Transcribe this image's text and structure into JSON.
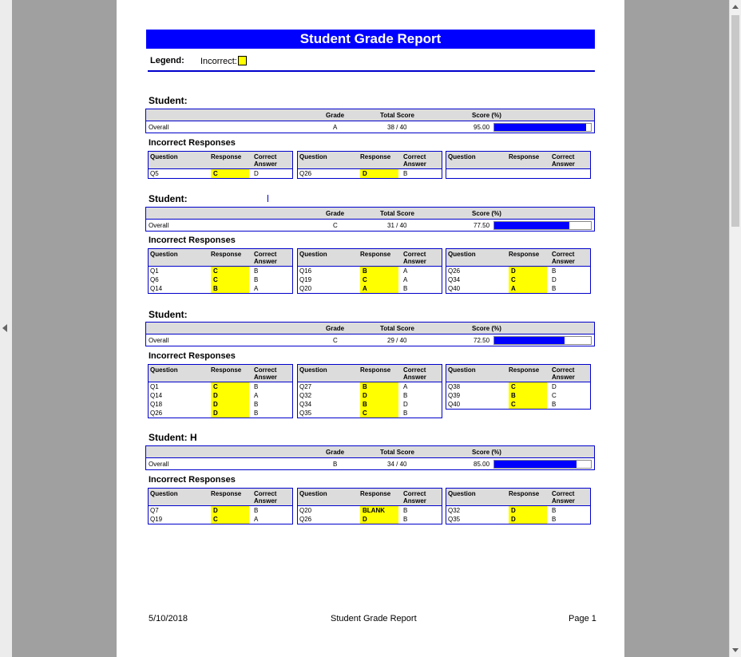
{
  "report": {
    "title": "Student Grade Report",
    "legend_label": "Legend:",
    "legend_incorrect": "Incorrect:",
    "highlight_color": "#ffff00",
    "accent_color": "#0000ff"
  },
  "labels": {
    "grade": "Grade",
    "total_score": "Total Score",
    "score_pct": "Score (%)",
    "incorrect_responses": "Incorrect Responses",
    "question": "Question",
    "response": "Response",
    "correct": "Correct",
    "answer": "Answer"
  },
  "students": [
    {
      "label": "Student:",
      "row": "Overall",
      "grade": "A",
      "total": "38 / 40",
      "pct": "95.00",
      "fraction": 0.95,
      "tables": [
        [
          [
            "Q5",
            "C",
            "D"
          ]
        ],
        [
          [
            "Q26",
            "D",
            "B"
          ]
        ],
        []
      ]
    },
    {
      "label": "Student:",
      "row": "Overall",
      "grade": "C",
      "total": "31 / 40",
      "pct": "77.50",
      "fraction": 0.775,
      "tables": [
        [
          [
            "Q1",
            "C",
            "B"
          ],
          [
            "Q6",
            "C",
            "B"
          ],
          [
            "Q14",
            "B",
            "A"
          ]
        ],
        [
          [
            "Q16",
            "B",
            "A"
          ],
          [
            "Q19",
            "C",
            "A"
          ],
          [
            "Q20",
            "A",
            "B"
          ]
        ],
        [
          [
            "Q26",
            "D",
            "B"
          ],
          [
            "Q34",
            "C",
            "D"
          ],
          [
            "Q40",
            "A",
            "B"
          ]
        ]
      ]
    },
    {
      "label": "Student:",
      "row": "Overall",
      "grade": "C",
      "total": "29 / 40",
      "pct": "72.50",
      "fraction": 0.725,
      "tables": [
        [
          [
            "Q1",
            "C",
            "B"
          ],
          [
            "Q14",
            "D",
            "A"
          ],
          [
            "Q18",
            "D",
            "B"
          ],
          [
            "Q26",
            "D",
            "B"
          ]
        ],
        [
          [
            "Q27",
            "B",
            "A"
          ],
          [
            "Q32",
            "D",
            "B"
          ],
          [
            "Q34",
            "B",
            "D"
          ],
          [
            "Q35",
            "C",
            "B"
          ]
        ],
        [
          [
            "Q38",
            "C",
            "D"
          ],
          [
            "Q39",
            "B",
            "C"
          ],
          [
            "Q40",
            "C",
            "B"
          ]
        ]
      ]
    },
    {
      "label": "Student: H",
      "row": "Overall",
      "grade": "B",
      "total": "34 / 40",
      "pct": "85.00",
      "fraction": 0.85,
      "tables": [
        [
          [
            "Q7",
            "D",
            "B"
          ],
          [
            "Q19",
            "C",
            "A"
          ]
        ],
        [
          [
            "Q20",
            "BLANK",
            "B"
          ],
          [
            "Q26",
            "D",
            "B"
          ]
        ],
        [
          [
            "Q32",
            "D",
            "B"
          ],
          [
            "Q35",
            "D",
            "B"
          ]
        ]
      ]
    }
  ],
  "footer": {
    "date": "5/10/2018",
    "title": "Student Grade Report",
    "page": "Page 1"
  }
}
